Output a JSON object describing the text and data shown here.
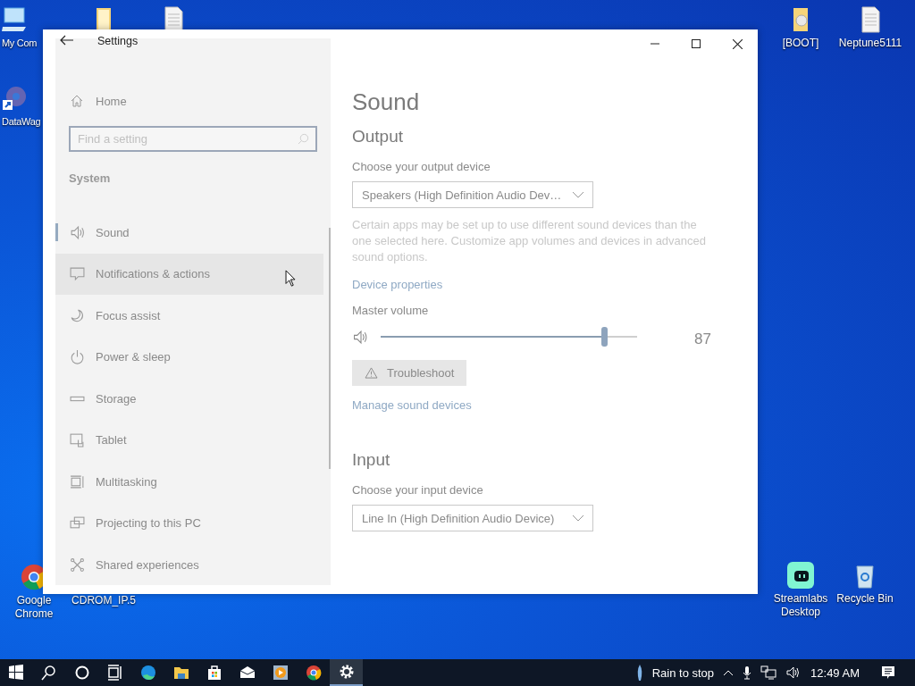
{
  "desktop": {
    "icons": [
      {
        "kind": "computer",
        "label": "My Com"
      },
      {
        "kind": "gear",
        "label": "DataWag"
      },
      {
        "kind": "folder"
      },
      {
        "kind": "document"
      },
      {
        "kind": "chrome",
        "label": "Google Chrome"
      },
      {
        "kind": "text",
        "label": "CDROM_IP.5"
      },
      {
        "kind": "disc",
        "label": "[BOOT]"
      },
      {
        "kind": "document",
        "label": "Neptune5111"
      },
      {
        "kind": "streamlabs",
        "label": "Streamlabs Desktop"
      },
      {
        "kind": "bin",
        "label": "Recycle Bin"
      }
    ]
  },
  "window": {
    "title": "Settings"
  },
  "sidebar": {
    "home": "Home",
    "search": {
      "placeholder": "Find a setting"
    },
    "section": "System",
    "items": [
      {
        "kind": "sound",
        "label": "Sound",
        "selected": true,
        "hovered": false
      },
      {
        "kind": "notifications",
        "label": "Notifications & actions",
        "selected": false,
        "hovered": true
      },
      {
        "kind": "focus",
        "label": "Focus assist",
        "selected": false,
        "hovered": false
      },
      {
        "kind": "power",
        "label": "Power & sleep",
        "selected": false,
        "hovered": false
      },
      {
        "kind": "storage",
        "label": "Storage",
        "selected": false,
        "hovered": false
      },
      {
        "kind": "tablet",
        "label": "Tablet",
        "selected": false,
        "hovered": false
      },
      {
        "kind": "multitasking",
        "label": "Multitasking",
        "selected": false,
        "hovered": false
      },
      {
        "kind": "projecting",
        "label": "Projecting to this PC",
        "selected": false,
        "hovered": false
      },
      {
        "kind": "shared",
        "label": "Shared experiences",
        "selected": false,
        "hovered": false
      }
    ]
  },
  "content": {
    "title": "Sound",
    "output": {
      "heading": "Output",
      "label": "Choose your output device",
      "device": "Speakers (High Definition Audio Dev…",
      "note": "Certain apps may be set up to use different sound devices than the one selected here. Customize app volumes and devices in advanced sound options.",
      "link": "Device properties"
    },
    "volume": {
      "label": "Master volume",
      "level": 0.87,
      "reading": "87"
    },
    "troubleshoot": "Troubleshoot",
    "manage_link": "Manage sound devices",
    "input": {
      "heading": "Input",
      "label": "Choose your input device",
      "device": "Line In (High Definition Audio Device)"
    }
  },
  "taskbar": {
    "apps": [
      {
        "kind": "start",
        "selected": false
      },
      {
        "kind": "search",
        "selected": false
      },
      {
        "kind": "cortana",
        "selected": false
      },
      {
        "kind": "taskview",
        "selected": false
      },
      {
        "kind": "edge",
        "selected": false
      },
      {
        "kind": "explorer",
        "selected": false
      },
      {
        "kind": "store",
        "selected": false
      },
      {
        "kind": "mail",
        "selected": false
      },
      {
        "kind": "media",
        "selected": false
      },
      {
        "kind": "chrome",
        "selected": false
      },
      {
        "kind": "settings",
        "selected": true
      }
    ],
    "weather": "Rain to stop",
    "clock": "12:49 AM"
  }
}
